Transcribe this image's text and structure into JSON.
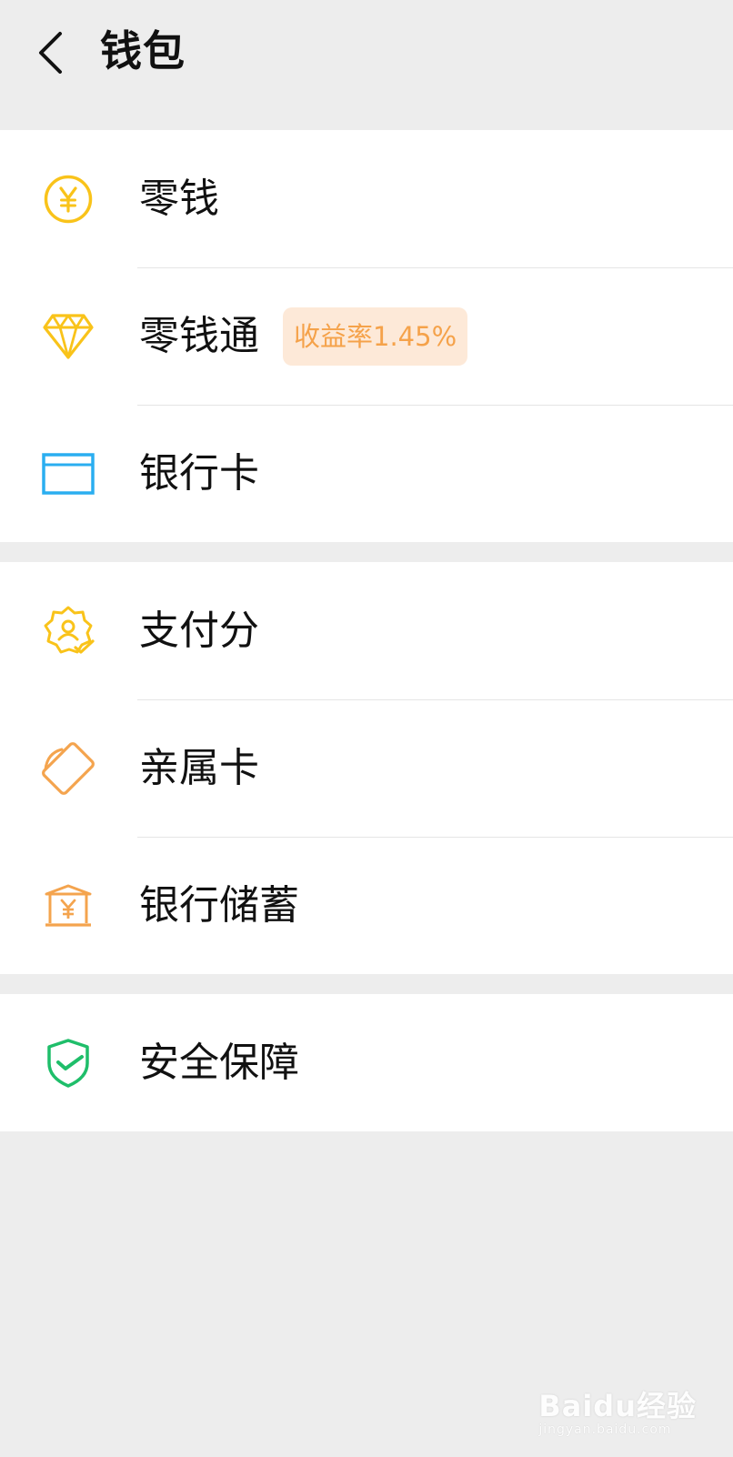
{
  "header": {
    "title": "钱包",
    "back_icon": "chevron-left-icon"
  },
  "groups": [
    {
      "items": [
        {
          "label": "零钱",
          "icon": "yuan-coin-icon",
          "icon_color": "#f9c31a"
        },
        {
          "label": "零钱通",
          "icon": "diamond-icon",
          "icon_color": "#f9c31a",
          "badge": "收益率1.45%"
        },
        {
          "label": "银行卡",
          "icon": "bank-card-icon",
          "icon_color": "#2aaef0"
        }
      ]
    },
    {
      "items": [
        {
          "label": "支付分",
          "icon": "badge-user-icon",
          "icon_color": "#f9c31a"
        },
        {
          "label": "亲属卡",
          "icon": "family-card-icon",
          "icon_color": "#f4a44e"
        },
        {
          "label": "银行储蓄",
          "icon": "bank-savings-icon",
          "icon_color": "#f4a44e"
        }
      ]
    },
    {
      "items": [
        {
          "label": "安全保障",
          "icon": "shield-check-icon",
          "icon_color": "#1fbe6a"
        }
      ]
    }
  ],
  "badge_colors": {
    "background": "#fde9d8",
    "text": "#f5a24a"
  },
  "watermark": {
    "main": "Baidu经验",
    "sub": "jingyan.baidu.com"
  }
}
